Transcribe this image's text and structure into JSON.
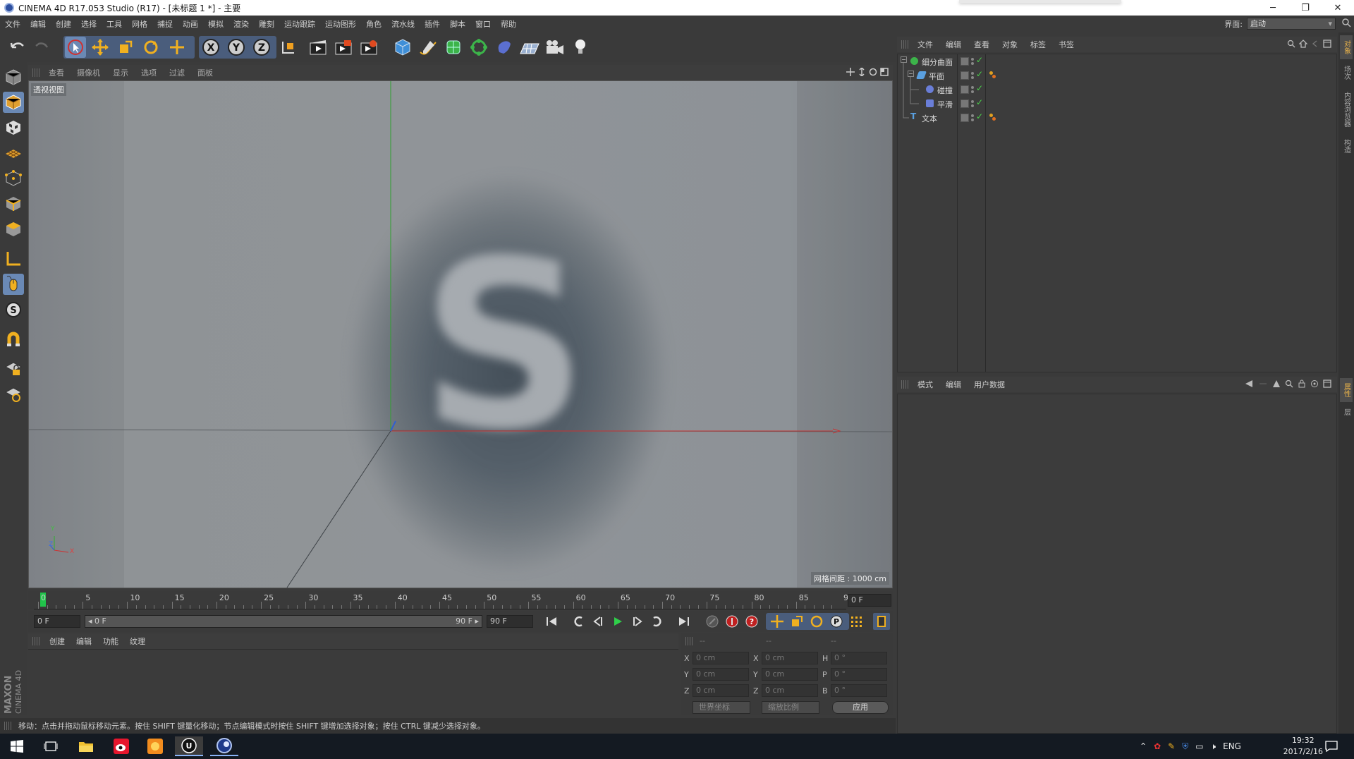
{
  "window": {
    "title": "CINEMA 4D R17.053 Studio (R17) - [未标题 1 *] - 主要",
    "minimize": "─",
    "restore": "❐",
    "close": "✕"
  },
  "menubar": {
    "items": [
      "文件",
      "编辑",
      "创建",
      "选择",
      "工具",
      "网格",
      "捕捉",
      "动画",
      "模拟",
      "渲染",
      "雕刻",
      "运动跟踪",
      "运动图形",
      "角色",
      "流水线",
      "插件",
      "脚本",
      "窗口",
      "帮助"
    ],
    "layout_label": "界面:",
    "layout_value": "启动"
  },
  "viewport": {
    "menu": [
      "查看",
      "摄像机",
      "显示",
      "选项",
      "过滤",
      "面板"
    ],
    "view_name": "透视视图",
    "grid_spacing": "网格间距 : 1000 cm",
    "object_letter": "S",
    "axis_y": "Y",
    "axis_z": "Z",
    "axis_x": "X"
  },
  "timeline": {
    "ticks": [
      "0",
      "5",
      "10",
      "15",
      "20",
      "25",
      "30",
      "35",
      "40",
      "45",
      "50",
      "55",
      "60",
      "65",
      "70",
      "75",
      "80",
      "85",
      "90"
    ],
    "current_frame": "0 F",
    "start_field": "0 F",
    "range_start": "◂ 0 F",
    "range_end": "90 F ▸",
    "end_field": "90 F"
  },
  "material_panel": {
    "menu": [
      "创建",
      "编辑",
      "功能",
      "纹理"
    ],
    "maxon_logo": "MAXON",
    "cinema_logo": "CINEMA 4D"
  },
  "coordinates": {
    "headers": [
      "--",
      "--",
      "--"
    ],
    "rows": [
      {
        "a": "X",
        "av": "0 cm",
        "b": "X",
        "bv": "0 cm",
        "c": "H",
        "cv": "0 °"
      },
      {
        "a": "Y",
        "av": "0 cm",
        "b": "Y",
        "bv": "0 cm",
        "c": "P",
        "cv": "0 °"
      },
      {
        "a": "Z",
        "av": "0 cm",
        "b": "Z",
        "bv": "0 cm",
        "c": "B",
        "cv": "0 °"
      }
    ],
    "space_dropdown": "世界坐标",
    "scale_dropdown": "缩放比例",
    "apply": "应用"
  },
  "status": {
    "text": "移动：点击并拖动鼠标移动元素。按住 SHIFT 键量化移动；节点编辑模式时按住 SHIFT 键增加选择对象；按住 CTRL 键减少选择对象。"
  },
  "object_manager": {
    "menu": [
      "文件",
      "编辑",
      "查看",
      "对象",
      "标签",
      "书签"
    ],
    "objects": [
      {
        "name": "细分曲面",
        "indent": 0,
        "tag": false
      },
      {
        "name": "平面",
        "indent": 1,
        "tag": true
      },
      {
        "name": "碰撞",
        "indent": 2,
        "tag": false
      },
      {
        "name": "平滑",
        "indent": 2,
        "tag": false
      },
      {
        "name": "文本",
        "indent": 0,
        "tag": true
      }
    ]
  },
  "attribute_manager": {
    "menu": [
      "模式",
      "编辑",
      "用户数据"
    ]
  },
  "right_tabs": {
    "top": [
      "对象",
      "场次",
      "内容浏览器",
      "构造"
    ],
    "bottom": [
      "属性",
      "层"
    ]
  },
  "taskbar": {
    "lang": "ENG",
    "time": "19:32",
    "date": "2017/2/16"
  },
  "colors": {
    "accent": "#6a89b5",
    "playhead": "#21c34a",
    "axis_x": "#d03030",
    "axis_y": "#30b030",
    "axis_z": "#3060d0"
  }
}
